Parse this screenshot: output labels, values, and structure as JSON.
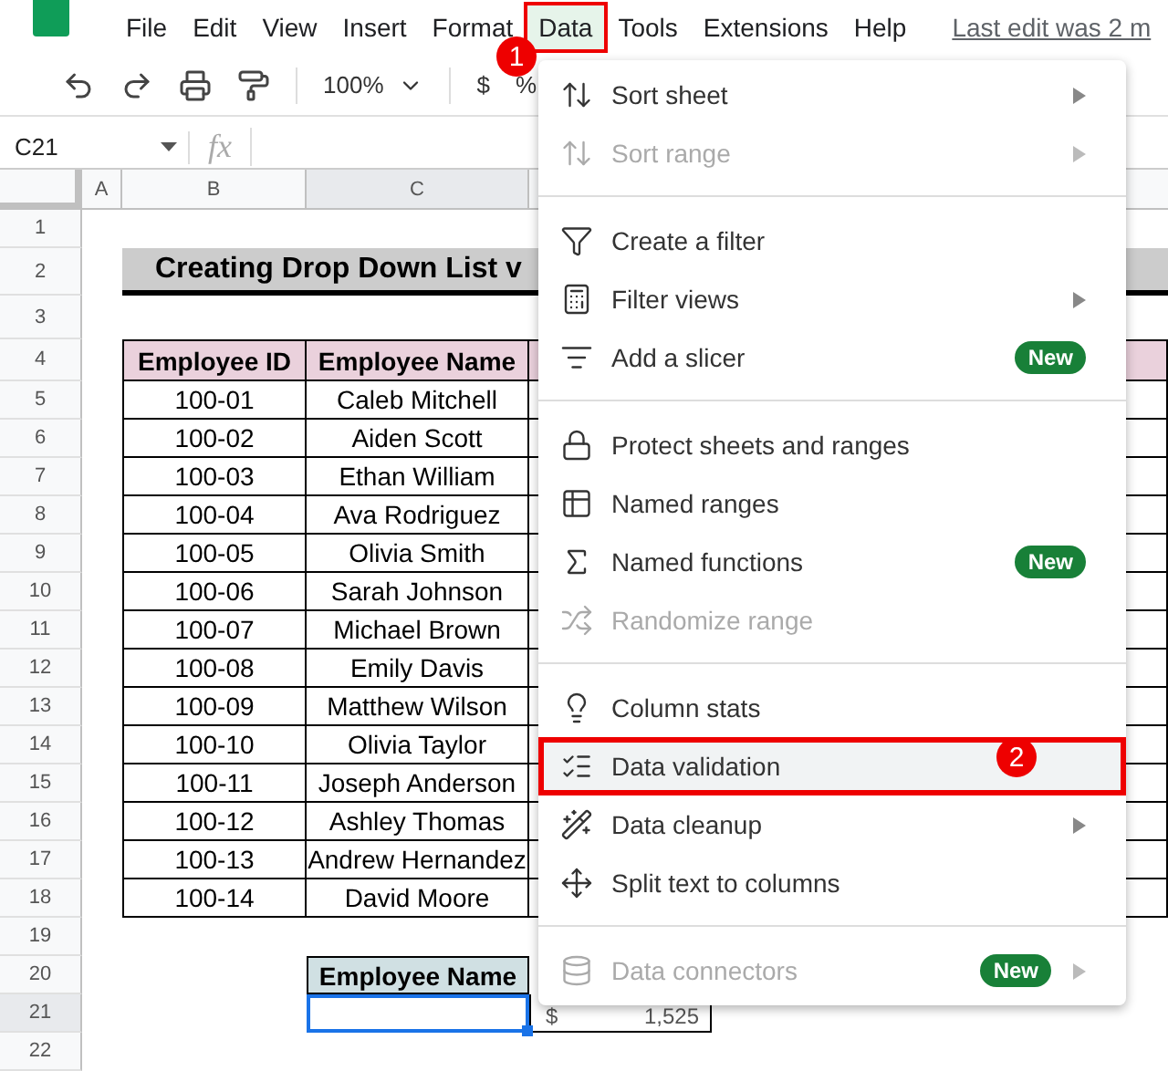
{
  "menu_bar": {
    "items": [
      {
        "label": "File",
        "selected": false
      },
      {
        "label": "Edit",
        "selected": false
      },
      {
        "label": "View",
        "selected": false
      },
      {
        "label": "Insert",
        "selected": false
      },
      {
        "label": "Format",
        "selected": false
      },
      {
        "label": "Data",
        "selected": true
      },
      {
        "label": "Tools",
        "selected": false
      },
      {
        "label": "Extensions",
        "selected": false
      },
      {
        "label": "Help",
        "selected": false
      }
    ],
    "last_edit": "Last edit was 2 m"
  },
  "toolbar": {
    "zoom": "100%",
    "currency": "$",
    "percent": "%"
  },
  "formula_bar": {
    "name_box": "C21",
    "fx": "fx"
  },
  "columns": [
    {
      "label": "A",
      "selected": false
    },
    {
      "label": "B",
      "selected": false
    },
    {
      "label": "C",
      "selected": true
    }
  ],
  "row_numbers": [
    "1",
    "2",
    "3",
    "4",
    "5",
    "6",
    "7",
    "8",
    "9",
    "10",
    "11",
    "12",
    "13",
    "14",
    "15",
    "16",
    "17",
    "18",
    "19",
    "20",
    "21",
    "22"
  ],
  "sheet": {
    "title": "Creating Drop Down List v",
    "table_headers": [
      "Employee ID",
      "Employee Name"
    ],
    "rows": [
      {
        "id": "100-01",
        "name": "Caleb Mitchell"
      },
      {
        "id": "100-02",
        "name": "Aiden Scott"
      },
      {
        "id": "100-03",
        "name": "Ethan William"
      },
      {
        "id": "100-04",
        "name": "Ava Rodriguez"
      },
      {
        "id": "100-05",
        "name": "Olivia Smith"
      },
      {
        "id": "100-06",
        "name": "Sarah Johnson"
      },
      {
        "id": "100-07",
        "name": "Michael Brown"
      },
      {
        "id": "100-08",
        "name": "Emily Davis"
      },
      {
        "id": "100-09",
        "name": "Matthew Wilson"
      },
      {
        "id": "100-10",
        "name": "Olivia Taylor"
      },
      {
        "id": "100-11",
        "name": "Joseph Anderson"
      },
      {
        "id": "100-12",
        "name": "Ashley Thomas"
      },
      {
        "id": "100-13",
        "name": "Andrew Hernandez"
      },
      {
        "id": "100-14",
        "name": "David Moore"
      }
    ],
    "lookup_header": "Employee Name",
    "result_currency": "$",
    "result_value": "1,525"
  },
  "data_menu": {
    "items": [
      {
        "kind": "item",
        "label": "Sort sheet",
        "disabled": false,
        "submenu": true,
        "selected": false
      },
      {
        "kind": "item",
        "label": "Sort range",
        "disabled": true,
        "submenu": true,
        "selected": false
      },
      {
        "kind": "divider"
      },
      {
        "kind": "item",
        "label": "Create a filter",
        "disabled": false,
        "submenu": false,
        "selected": false
      },
      {
        "kind": "item",
        "label": "Filter views",
        "disabled": false,
        "submenu": true,
        "selected": false
      },
      {
        "kind": "item",
        "label": "Add a slicer",
        "disabled": false,
        "submenu": false,
        "badge": "New",
        "selected": false
      },
      {
        "kind": "divider"
      },
      {
        "kind": "item",
        "label": "Protect sheets and ranges",
        "disabled": false,
        "submenu": false,
        "selected": false
      },
      {
        "kind": "item",
        "label": "Named ranges",
        "disabled": false,
        "submenu": false,
        "selected": false
      },
      {
        "kind": "item",
        "label": "Named functions",
        "disabled": false,
        "submenu": false,
        "badge": "New",
        "selected": false
      },
      {
        "kind": "item",
        "label": "Randomize range",
        "disabled": true,
        "submenu": false,
        "selected": false
      },
      {
        "kind": "divider"
      },
      {
        "kind": "item",
        "label": "Column stats",
        "disabled": false,
        "submenu": false,
        "selected": false
      },
      {
        "kind": "item",
        "label": "Data validation",
        "disabled": false,
        "submenu": false,
        "selected": true
      },
      {
        "kind": "item",
        "label": "Data cleanup",
        "disabled": false,
        "submenu": true,
        "selected": false
      },
      {
        "kind": "item",
        "label": "Split text to columns",
        "disabled": false,
        "submenu": false,
        "selected": false
      },
      {
        "kind": "divider"
      },
      {
        "kind": "item",
        "label": "Data connectors",
        "disabled": true,
        "submenu": true,
        "badge": "New",
        "selected": false
      }
    ]
  },
  "callouts": [
    "1",
    "2"
  ]
}
